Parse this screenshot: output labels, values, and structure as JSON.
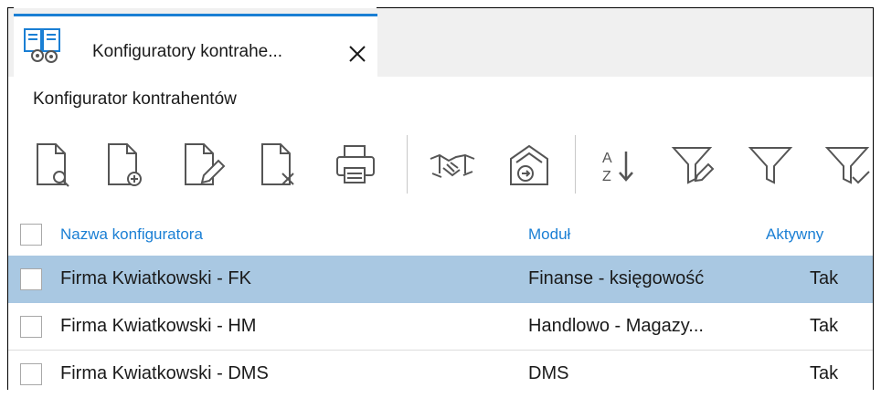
{
  "tab": {
    "icon": "configurator-icon",
    "label": "Konfiguratory kontrahe...",
    "close_icon": "close-icon"
  },
  "section_title": "Konfigurator kontrahentów",
  "toolbar": {
    "buttons": [
      {
        "name": "preview-document-icon"
      },
      {
        "name": "add-document-icon"
      },
      {
        "name": "edit-document-icon"
      },
      {
        "name": "delete-document-icon"
      },
      {
        "name": "print-icon"
      },
      {
        "name": "handshake-icon"
      },
      {
        "name": "import-warehouse-icon"
      },
      {
        "name": "sort-az-icon"
      },
      {
        "name": "filter-edit-icon"
      },
      {
        "name": "filter-icon"
      },
      {
        "name": "filter-check-icon"
      }
    ],
    "accent": "#1a7fd4"
  },
  "table": {
    "columns": [
      "Nazwa konfiguratora",
      "Moduł",
      "Aktywny"
    ],
    "rows": [
      {
        "name": "Firma Kwiatkowski - FK",
        "module": "Finanse - księgowość",
        "active": "Tak",
        "selected": true
      },
      {
        "name": "Firma Kwiatkowski - HM",
        "module": "Handlowo - Magazy...",
        "active": "Tak",
        "selected": false
      },
      {
        "name": "Firma Kwiatkowski - DMS",
        "module": "DMS",
        "active": "Tak",
        "selected": false
      }
    ],
    "selected_color": "#a9c8e2",
    "header_color": "#1a7fd4"
  }
}
